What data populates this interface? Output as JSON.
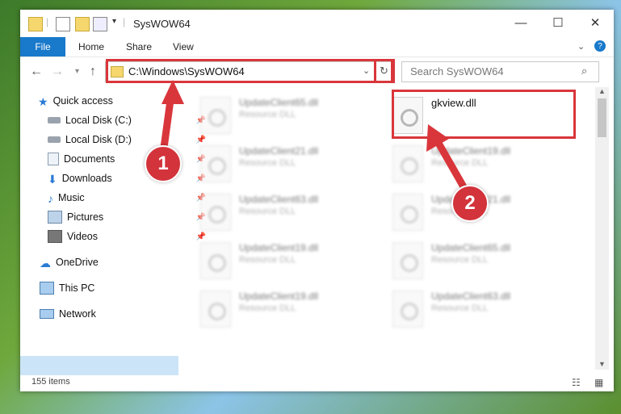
{
  "window": {
    "title": "SysWOW64"
  },
  "ribbon": {
    "file": "File",
    "tabs": [
      "Home",
      "Share",
      "View"
    ]
  },
  "address": {
    "path": "C:\\Windows\\SysWOW64"
  },
  "search": {
    "placeholder": "Search SysWOW64"
  },
  "sidebar": {
    "items": [
      {
        "label": "Quick access",
        "icon": "star-icon"
      },
      {
        "label": "Local Disk (C:)",
        "icon": "drive-icon"
      },
      {
        "label": "Local Disk (D:)",
        "icon": "drive-icon"
      },
      {
        "label": "Documents",
        "icon": "documents-icon"
      },
      {
        "label": "Downloads",
        "icon": "downloads-icon"
      },
      {
        "label": "Music",
        "icon": "music-icon"
      },
      {
        "label": "Pictures",
        "icon": "pictures-icon"
      },
      {
        "label": "Videos",
        "icon": "videos-icon"
      },
      {
        "label": "OneDrive",
        "icon": "cloud-icon"
      },
      {
        "label": "This PC",
        "icon": "computer-icon"
      },
      {
        "label": "Network",
        "icon": "network-icon"
      }
    ]
  },
  "files": [
    {
      "name": "UpdateClient65.dll",
      "type": "Resource DLL"
    },
    {
      "name": "gkview.dll",
      "type": ""
    },
    {
      "name": "UpdateClient21.dll",
      "type": "Resource DLL"
    },
    {
      "name": "UpdateClient19.dll",
      "type": "Resource DLL"
    },
    {
      "name": "UpdateClient63.dll",
      "type": "Resource DLL"
    },
    {
      "name": "UpdateClient21.dll",
      "type": "Resource DLL"
    },
    {
      "name": "UpdateClient19.dll",
      "type": "Resource DLL"
    },
    {
      "name": "UpdateClient65.dll",
      "type": "Resource DLL"
    },
    {
      "name": "UpdateClient19.dll",
      "type": "Resource DLL"
    },
    {
      "name": "UpdateClient63.dll",
      "type": "Resource DLL"
    }
  ],
  "status": {
    "items": "155 items"
  },
  "annotations": {
    "step1": "1",
    "step2": "2"
  },
  "colors": {
    "accent": "#1979ca",
    "highlight": "#d9363b"
  }
}
